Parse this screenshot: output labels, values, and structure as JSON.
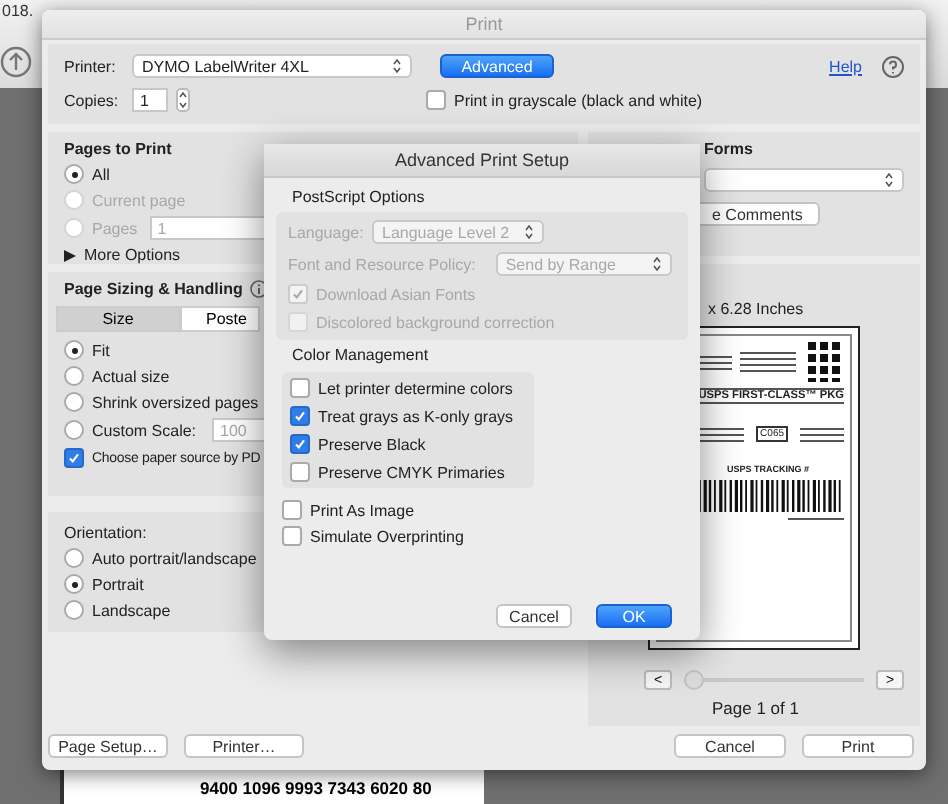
{
  "background_document": {
    "tab_title": "018.",
    "barcode_number": "9400 1096 9993 7343 6020 80"
  },
  "window": {
    "title": "Print"
  },
  "printer": {
    "label": "Printer:",
    "value": "DYMO LabelWriter 4XL"
  },
  "advanced_button": "Advanced",
  "help_link": "Help",
  "copies": {
    "label": "Copies:",
    "value": "1"
  },
  "grayscale": {
    "label": "Print in grayscale (black and white)",
    "checked": false
  },
  "pages_to_print": {
    "title": "Pages to Print",
    "options": [
      {
        "label": "All",
        "selected": true,
        "disabled": false
      },
      {
        "label": "Current page",
        "selected": false,
        "disabled": true
      },
      {
        "label": "Pages",
        "selected": false,
        "disabled": true
      }
    ],
    "pages_value": "1",
    "more_options": "More Options"
  },
  "page_sizing": {
    "title": "Page Sizing & Handling",
    "tabs": [
      {
        "label": "Size",
        "selected": true
      },
      {
        "label": "Poste",
        "selected": false
      }
    ],
    "options": [
      {
        "label": "Fit",
        "selected": true
      },
      {
        "label": "Actual size",
        "selected": false
      },
      {
        "label": "Shrink oversized pages",
        "selected": false
      },
      {
        "label": "Custom Scale:",
        "selected": false
      }
    ],
    "scale_value": "100",
    "paper_source": {
      "label": "Choose paper source by PD",
      "checked": true
    }
  },
  "orientation": {
    "title": "Orientation:",
    "options": [
      {
        "label": "Auto portrait/landscape",
        "selected": false
      },
      {
        "label": "Portrait",
        "selected": true
      },
      {
        "label": "Landscape",
        "selected": false
      }
    ]
  },
  "bottom_left_buttons": [
    "Page Setup…",
    "Printer…"
  ],
  "comments_forms": {
    "title": "Forms",
    "button": "e Comments"
  },
  "preview": {
    "size_text": "x 6.28 Inches",
    "label_service": "USPS FIRST-CLASS™ PKG",
    "label_code": "C065",
    "tracking_title": "USPS TRACKING #",
    "prev": "<",
    "next": ">",
    "level": 0,
    "page_text": "Page 1 of 1"
  },
  "bottom_right_buttons": [
    "Cancel",
    "Print"
  ],
  "advanced_dialog": {
    "title": "Advanced Print Setup",
    "postscript_title": "PostScript Options",
    "language": {
      "label": "Language:",
      "value": "Language Level 2"
    },
    "font_policy": {
      "label": "Font and Resource Policy:",
      "value": "Send by Range"
    },
    "postscript_checks": [
      {
        "label": "Download Asian Fonts",
        "checked": true,
        "disabled": true
      },
      {
        "label": "Discolored background correction",
        "checked": false,
        "disabled": true
      }
    ],
    "color_title": "Color Management",
    "color_checks": [
      {
        "label": "Let printer determine colors",
        "checked": false
      },
      {
        "label": "Treat grays as K-only grays",
        "checked": true
      },
      {
        "label": "Preserve Black",
        "checked": true
      },
      {
        "label": "Preserve CMYK Primaries",
        "checked": false
      }
    ],
    "other_checks": [
      {
        "label": "Print As Image",
        "checked": false
      },
      {
        "label": "Simulate Overprinting",
        "checked": false
      }
    ],
    "buttons": [
      {
        "label": "Cancel",
        "default": false
      },
      {
        "label": "OK",
        "default": true
      }
    ]
  }
}
